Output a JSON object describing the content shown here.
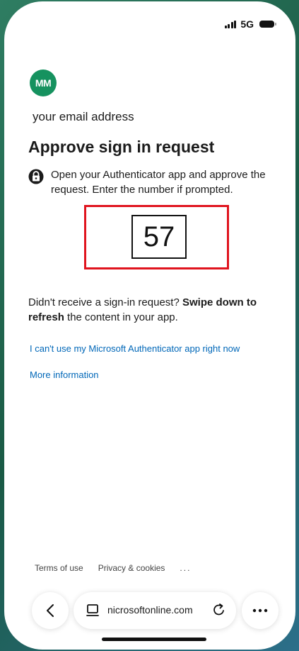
{
  "status_bar": {
    "network": "5G"
  },
  "account": {
    "initials": "MM",
    "email": "your email address"
  },
  "page": {
    "title": "Approve sign in request",
    "instruction": "Open your Authenticator app and approve the request. Enter the number if prompted.",
    "number": "57",
    "didnt_receive_prefix": "Didn't receive a sign-in request? ",
    "didnt_receive_bold": "Swipe down to refresh",
    "didnt_receive_suffix": " the content in your app.",
    "link_cant_use": "I can't use my Microsoft Authenticator app right now",
    "link_more_info": "More information"
  },
  "footer": {
    "terms": "Terms of use",
    "privacy": "Privacy & cookies",
    "more": "..."
  },
  "browser": {
    "url": "nicrosoftonline.com"
  },
  "colors": {
    "avatar": "#16925f",
    "link": "#0067b8",
    "highlight": "#e0141e"
  },
  "icons": [
    "lock-icon",
    "back-icon",
    "tabs-icon",
    "reload-icon",
    "more-icon"
  ]
}
